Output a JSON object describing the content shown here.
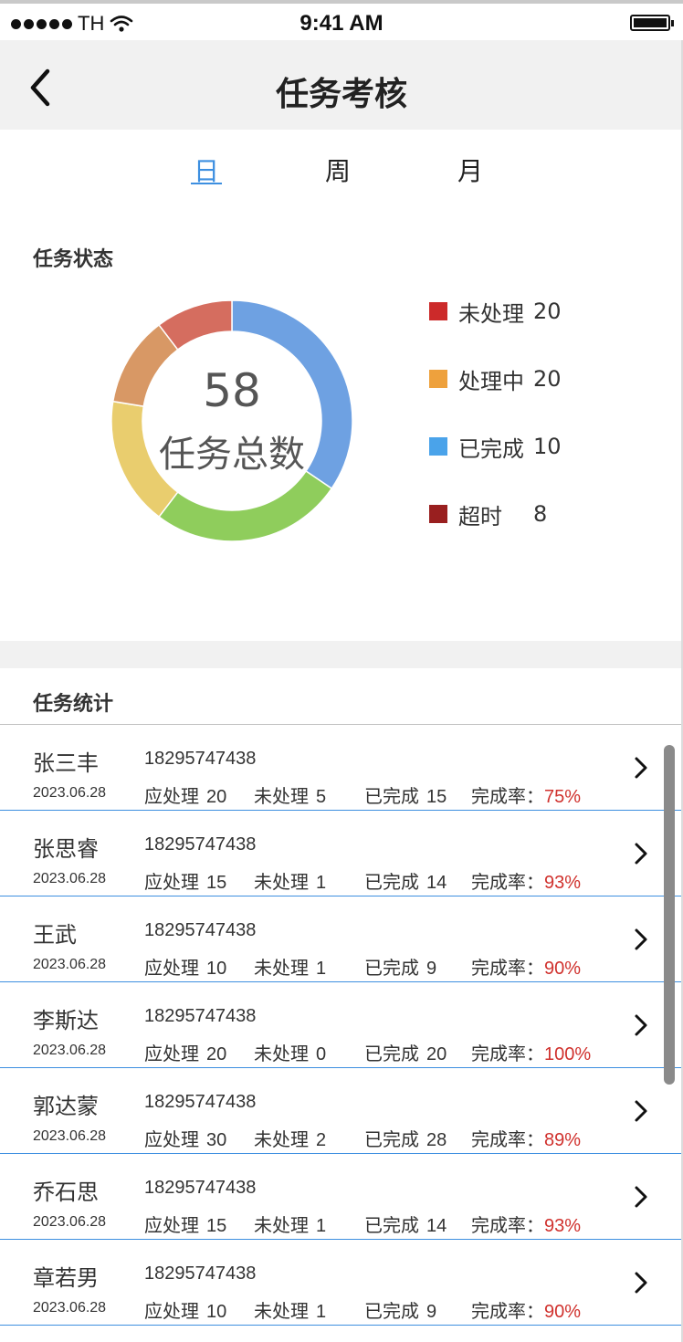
{
  "status_bar": {
    "carrier": "TH",
    "time": "9:41 AM",
    "signal_icon": "signal-dots-icon",
    "wifi_icon": "wifi-icon",
    "battery_icon": "battery-icon"
  },
  "header": {
    "title": "任务考核",
    "back_icon": "chevron-left-icon"
  },
  "tabs": [
    {
      "label": "日",
      "active": true
    },
    {
      "label": "周",
      "active": false
    },
    {
      "label": "月",
      "active": false
    }
  ],
  "status_section": {
    "title": "任务状态",
    "total_value": "58",
    "total_label": "任务总数",
    "legend": [
      {
        "label": "未处理",
        "value": "20",
        "color": "#cc2a2a"
      },
      {
        "label": "处理中",
        "value": "20",
        "color": "#eea13d"
      },
      {
        "label": "已完成",
        "value": "10",
        "color": "#4aa3ea"
      },
      {
        "label": "超时",
        "value": "8",
        "color": "#991f1f"
      }
    ],
    "donut_segments": [
      {
        "value": 20,
        "color": "#6ea1e2"
      },
      {
        "value": 15,
        "color": "#8fcd5c"
      },
      {
        "value": 10,
        "color": "#e9cd6e"
      },
      {
        "value": 7,
        "color": "#d89865"
      },
      {
        "value": 6,
        "color": "#d56d5f"
      }
    ]
  },
  "stats_section": {
    "title": "任务统计",
    "labels": {
      "should": "应处理",
      "pending": "未处理",
      "done": "已完成",
      "rate": "完成率："
    },
    "rows": [
      {
        "name": "张三丰",
        "phone": "18295747438",
        "date": "2023.06.28",
        "should": "20",
        "pending": "5",
        "done": "15",
        "rate": "75%"
      },
      {
        "name": "张思睿",
        "phone": "18295747438",
        "date": "2023.06.28",
        "should": "15",
        "pending": "1",
        "done": "14",
        "rate": "93%"
      },
      {
        "name": "王武",
        "phone": "18295747438",
        "date": "2023.06.28",
        "should": "10",
        "pending": "1",
        "done": "9",
        "rate": "90%"
      },
      {
        "name": "李斯达",
        "phone": "18295747438",
        "date": "2023.06.28",
        "should": "20",
        "pending": "0",
        "done": "20",
        "rate": "100%"
      },
      {
        "name": "郭达蒙",
        "phone": "18295747438",
        "date": "2023.06.28",
        "should": "30",
        "pending": "2",
        "done": "28",
        "rate": "89%"
      },
      {
        "name": "乔石思",
        "phone": "18295747438",
        "date": "2023.06.28",
        "should": "15",
        "pending": "1",
        "done": "14",
        "rate": "93%"
      },
      {
        "name": "章若男",
        "phone": "18295747438",
        "date": "2023.06.28",
        "should": "10",
        "pending": "1",
        "done": "9",
        "rate": "90%"
      }
    ],
    "row_chevron_icon": "chevron-right-icon"
  }
}
